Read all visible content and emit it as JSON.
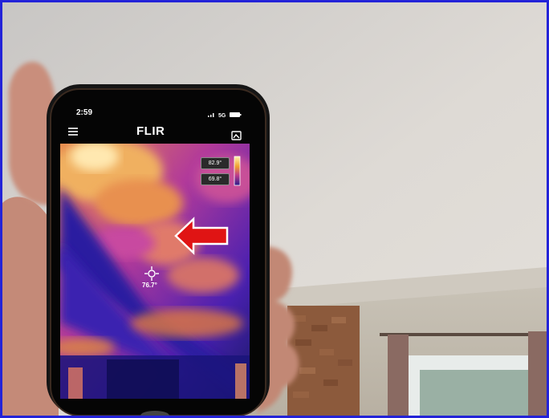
{
  "status_bar": {
    "time": "2:59",
    "network": "5G"
  },
  "camera_app": {
    "brand": "FLIR",
    "scale_high": "82.9°",
    "scale_low": "69.8°",
    "spot_temp": "76.7°",
    "icons": [
      "menu-icon",
      "flir-logo-icon",
      "gallery-icon",
      "crosshair-icon",
      "arrow-left-icon"
    ]
  },
  "colors": {
    "frame_border": "#2323d8",
    "annotation_arrow": "#e01414",
    "ceiling": "#dedad6"
  }
}
